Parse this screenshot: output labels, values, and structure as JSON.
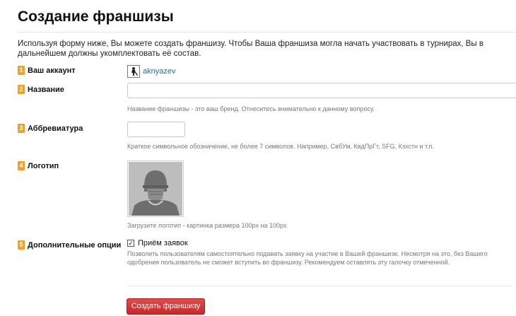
{
  "page": {
    "title": "Создание франшизы",
    "intro": "Используя форму ниже, Вы можете создать франшизу. Чтобы Ваша франшиза могла начать участвовать в турнирах, Вы в дальнейшем должны укомплектовать её состав."
  },
  "form": {
    "account": {
      "number": "1",
      "label": "Ваш аккаунт",
      "username": "aknyazev",
      "icon": "hockey-player-icon"
    },
    "name": {
      "number": "2",
      "label": "Название",
      "value": "",
      "hint": "Название франшизы - это ваш бренд. Отнеситесь внимательно к данному вопросу."
    },
    "abbr": {
      "number": "3",
      "label": "Аббревиатура",
      "value": "",
      "hint": "Краткое символьное обозначение, не более 7 символов. Например, СвбУм, КвдПрГт, SFG, Кзхстн и т.п."
    },
    "logo": {
      "number": "4",
      "label": "Логотип",
      "icon": "hockey-player-placeholder",
      "hint": "Загрузите логотип - картинка размера 100px на 100px"
    },
    "options": {
      "number": "5",
      "label": "Дополнительные опции",
      "checkbox_label": "Приём заявок",
      "checked": true,
      "hint": "Позволить пользователям самостоятельно подавать заявку на участие в Вашей франшизе. Несмотря на это, без Вашего одобрения пользователь не сможет вступить во франшизу. Рекомендуем оставлять эту галочку отмеченной."
    }
  },
  "submit_label": "Создать франшизу",
  "colors": {
    "step_badge": "#f0a12a",
    "link": "#2a6aa3",
    "submit": "#d43535"
  }
}
